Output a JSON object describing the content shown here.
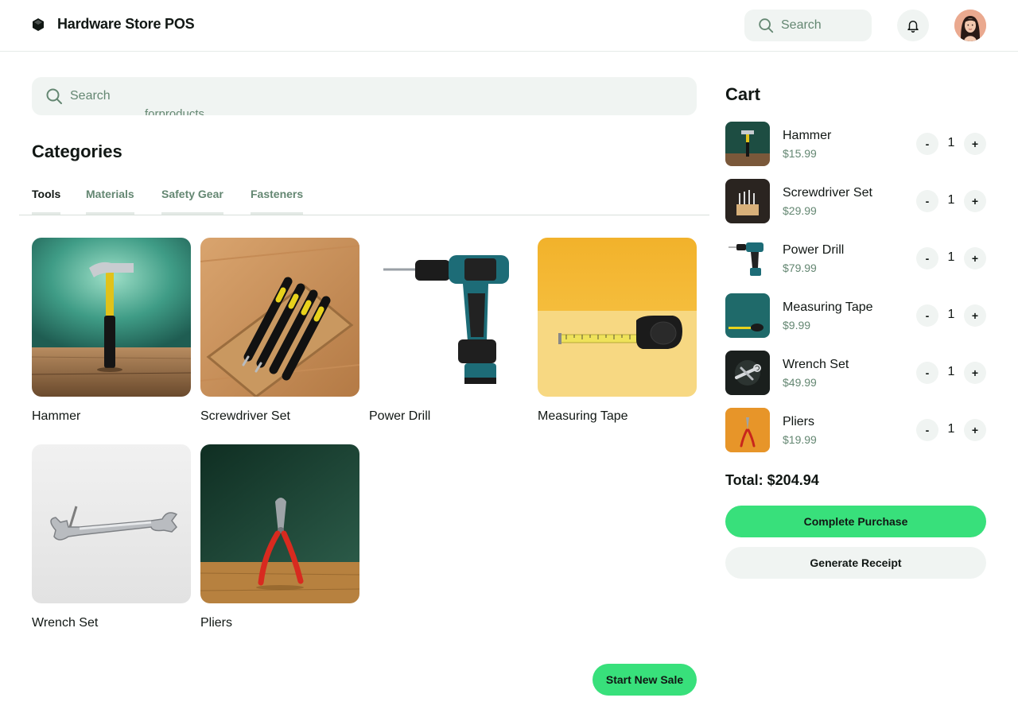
{
  "header": {
    "title": "Hardware Store POS",
    "logo_icon": "cube-icon",
    "search_placeholder": "Search",
    "notification_icon": "bell-icon",
    "avatar_icon": "user-avatar"
  },
  "main": {
    "search_placeholder": "Search",
    "search_overflow_text": "forproducts",
    "categories_title": "Categories",
    "tabs": [
      {
        "label": "Tools",
        "active": true
      },
      {
        "label": "Materials",
        "active": false
      },
      {
        "label": "Safety Gear",
        "active": false
      },
      {
        "label": "Fasteners",
        "active": false
      }
    ],
    "products": [
      {
        "name": "Hammer",
        "image": "hammer-image"
      },
      {
        "name": "Screwdriver Set",
        "image": "screwdriver-set-image"
      },
      {
        "name": "Power Drill",
        "image": "power-drill-image"
      },
      {
        "name": "Measuring Tape",
        "image": "measuring-tape-image"
      },
      {
        "name": "Wrench Set",
        "image": "wrench-set-image"
      },
      {
        "name": "Pliers",
        "image": "pliers-image"
      }
    ],
    "start_new_sale_label": "Start New Sale"
  },
  "cart": {
    "title": "Cart",
    "items": [
      {
        "name": "Hammer",
        "price": "$15.99",
        "qty": "1",
        "minus": "-",
        "plus": "+"
      },
      {
        "name": "Screwdriver Set",
        "price": "$29.99",
        "qty": "1",
        "minus": "-",
        "plus": "+"
      },
      {
        "name": "Power Drill",
        "price": "$79.99",
        "qty": "1",
        "minus": "-",
        "plus": "+"
      },
      {
        "name": "Measuring Tape",
        "price": "$9.99",
        "qty": "1",
        "minus": "-",
        "plus": "+"
      },
      {
        "name": "Wrench Set",
        "price": "$49.99",
        "qty": "1",
        "minus": "-",
        "plus": "+"
      },
      {
        "name": "Pliers",
        "price": "$19.99",
        "qty": "1",
        "minus": "-",
        "plus": "+"
      }
    ],
    "total": "Total: $204.94",
    "complete_label": "Complete Purchase",
    "receipt_label": "Generate Receipt"
  },
  "colors": {
    "accent": "#38e07b",
    "muted_text": "#648772",
    "surface": "#f0f4f2",
    "text": "#111714"
  }
}
